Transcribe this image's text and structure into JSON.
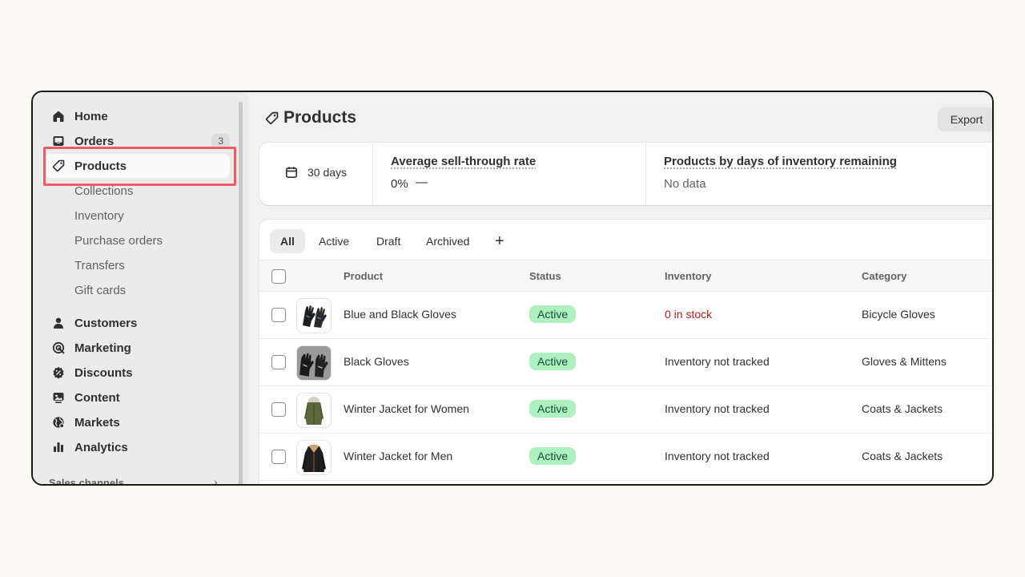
{
  "sidebar": {
    "items": [
      {
        "label": "Home",
        "icon": "home-icon"
      },
      {
        "label": "Orders",
        "icon": "inbox-icon",
        "badge": "3"
      },
      {
        "label": "Products",
        "icon": "tag-icon",
        "active": true
      },
      {
        "label": "Customers",
        "icon": "person-icon"
      },
      {
        "label": "Marketing",
        "icon": "target-icon"
      },
      {
        "label": "Discounts",
        "icon": "discount-icon"
      },
      {
        "label": "Content",
        "icon": "image-icon"
      },
      {
        "label": "Markets",
        "icon": "globe-icon"
      },
      {
        "label": "Analytics",
        "icon": "bar-chart-icon"
      }
    ],
    "sub_items": [
      "Collections",
      "Inventory",
      "Purchase orders",
      "Transfers",
      "Gift cards"
    ],
    "section_label": "Sales channels"
  },
  "header": {
    "title": "Products",
    "export_label": "Export"
  },
  "stats": {
    "date_range": "30 days",
    "sell_through_title": "Average sell-through rate",
    "sell_through_value": "0%",
    "sell_through_trend": "—",
    "inventory_days_title": "Products by days of inventory remaining",
    "inventory_days_value": "No data"
  },
  "tabs": [
    "All",
    "Active",
    "Draft",
    "Archived"
  ],
  "table": {
    "columns": [
      "Product",
      "Status",
      "Inventory",
      "Category"
    ],
    "rows": [
      {
        "product": "Blue and Black Gloves",
        "status": "Active",
        "inventory": "0 in stock",
        "category": "Bicycle Gloves"
      },
      {
        "product": "Black Gloves",
        "status": "Active",
        "inventory": "Inventory not tracked",
        "category": "Gloves & Mittens"
      },
      {
        "product": "Winter Jacket for Women",
        "status": "Active",
        "inventory": "Inventory not tracked",
        "category": "Coats & Jackets"
      },
      {
        "product": "Winter Jacket for Men",
        "status": "Active",
        "inventory": "Inventory not tracked",
        "category": "Coats & Jackets"
      }
    ]
  },
  "colors": {
    "highlight": "#ef5b64",
    "status_active_bg": "#aff0c0",
    "status_active_text": "#0c5132",
    "danger_text": "#b21c1c"
  }
}
